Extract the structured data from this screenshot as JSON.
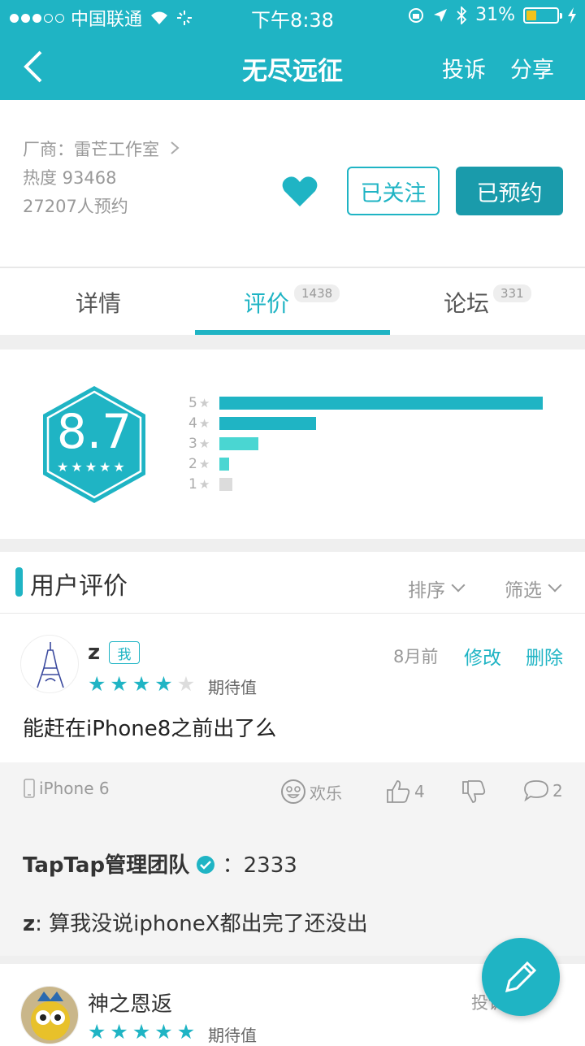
{
  "status_bar": {
    "carrier": "中国联通",
    "time": "下午8:38",
    "battery": "31%"
  },
  "header": {
    "title": "无尽远征",
    "complain": "投诉",
    "share": "分享"
  },
  "info": {
    "vendor": "厂商：雷芒工作室",
    "heat": "热度 93468",
    "reservations": "27207人预约"
  },
  "actions": {
    "follow": "已关注",
    "reserved": "已预约"
  },
  "tabs": [
    {
      "label": "详情",
      "count": ""
    },
    {
      "label": "评价",
      "count": "1438",
      "active": true
    },
    {
      "label": "论坛",
      "count": "331"
    }
  ],
  "rating": {
    "score": "8.7",
    "star_fraction": 0.87,
    "distribution": [
      {
        "label": "5",
        "share": 1.0,
        "color": "#1fb4c4"
      },
      {
        "label": "4",
        "share": 0.3,
        "color": "#1fb4c4"
      },
      {
        "label": "3",
        "share": 0.12,
        "color": "#4ad6d2"
      },
      {
        "label": "2",
        "share": 0.03,
        "color": "#4ad6d2"
      },
      {
        "label": "1",
        "share": 0.04,
        "color": "#dcdcdc"
      }
    ]
  },
  "reviews_section": {
    "title": "用户评价",
    "sort": "排序",
    "filter": "筛选"
  },
  "review": {
    "user": "z",
    "me_badge": "我",
    "stars": 4,
    "tag": "期待值",
    "time": "8月前",
    "edit": "修改",
    "delete": "删除",
    "text": "能赶在iPhone8之前出了么",
    "device": "iPhone 6",
    "mood": "欢乐",
    "likes": "4",
    "comments": "2",
    "replies": [
      {
        "author": "TapTap管理团队",
        "separator": "：",
        "text": "2333"
      },
      {
        "author": "z",
        "separator": ": ",
        "text": "算我没说iphoneX都出完了还没出"
      }
    ]
  },
  "review2": {
    "user": "神之恩返",
    "stars": 5,
    "tag": "期待值",
    "stub": "投诉 前"
  },
  "colors": {
    "brand": "#1fb4c4",
    "brand_dark": "#1a9bab"
  }
}
